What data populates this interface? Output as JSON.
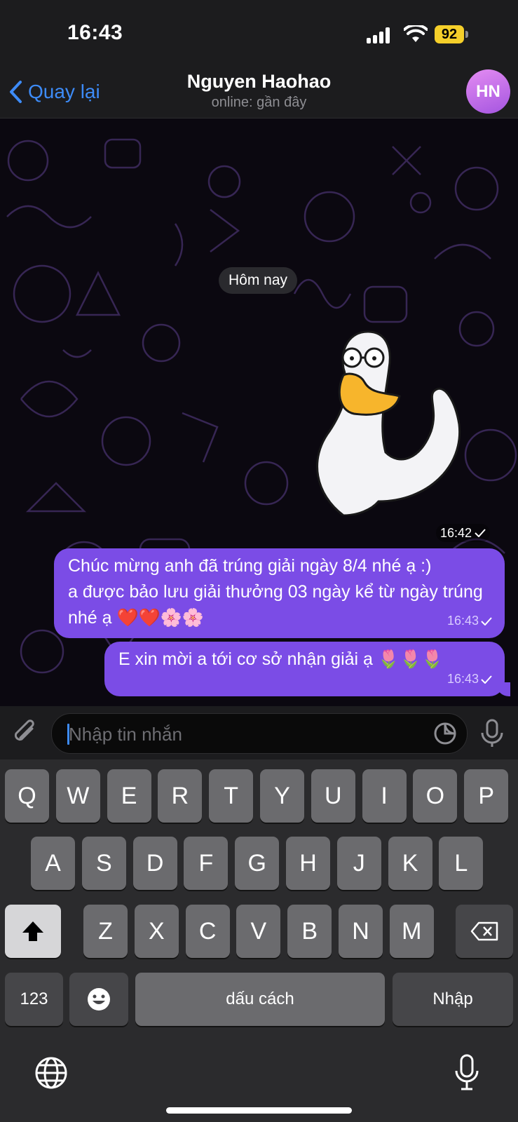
{
  "status_bar": {
    "time": "16:43",
    "battery": "92"
  },
  "nav": {
    "back_label": "Quay lại",
    "contact_name": "Nguyen Haohao",
    "presence": "online: gần đây",
    "avatar_initials": "HN"
  },
  "chat": {
    "date_separator": "Hôm nay",
    "sticker": {
      "time": "16:42",
      "icon": "duck-sticker"
    },
    "messages": [
      {
        "text": "Chúc mừng anh đã trúng giải ngày 8/4 nhé ạ :)\na được bảo lưu giải thưởng 03 ngày kể từ ngày trúng nhé ạ ❤️❤️🌸🌸",
        "time": "16:43"
      },
      {
        "text": "E xin mời a tới cơ sở nhận giải ạ 🌷🌷🌷",
        "time": "16:43"
      }
    ]
  },
  "input": {
    "placeholder": "Nhập tin nhắn"
  },
  "keyboard": {
    "row1": [
      "Q",
      "W",
      "E",
      "R",
      "T",
      "Y",
      "U",
      "I",
      "O",
      "P"
    ],
    "row2": [
      "A",
      "S",
      "D",
      "F",
      "G",
      "H",
      "J",
      "K",
      "L"
    ],
    "row3": [
      "Z",
      "X",
      "C",
      "V",
      "B",
      "N",
      "M"
    ],
    "numbers_key": "123",
    "space_key": "dấu cách",
    "return_key": "Nhập"
  },
  "colors": {
    "accent": "#3d8bf7",
    "bubble": "#7b4ce6",
    "battery": "#f5cf2a"
  }
}
